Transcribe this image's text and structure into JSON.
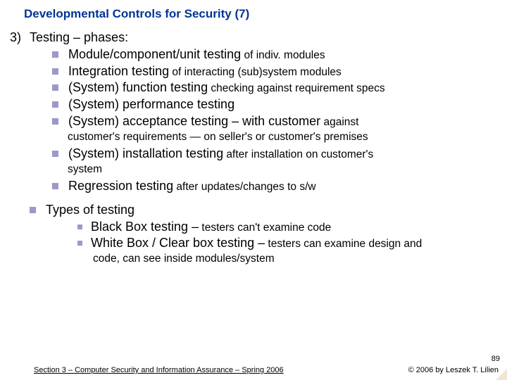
{
  "title": "Developmental Controls for Security (7)",
  "main": {
    "number": "3)",
    "heading": "Testing – phases:",
    "items": [
      {
        "main": "Module/component/unit testing",
        "tail": " of indiv. modules"
      },
      {
        "main": "Integration testing",
        "tail": " of interacting (sub)system modules"
      },
      {
        "main": "(System) function testing",
        "tail": " checking against requirement specs"
      },
      {
        "main": "(System) performance testing",
        "tail": ""
      },
      {
        "main": "(System) acceptance testing – with customer",
        "tail": " against",
        "cont": "customer's requirements — on seller's or customer's premises"
      },
      {
        "main": "(System) installation testing",
        "tail": " after installation on customer's",
        "cont": "system"
      },
      {
        "main": "Regression testing",
        "tail": " after updates/changes to s/w"
      }
    ]
  },
  "types": {
    "heading": "Types of testing",
    "items": [
      {
        "main": "Black Box testing –",
        "tail": " testers can't examine code"
      },
      {
        "main": "White Box / Clear box testing –",
        "tail": " testers can examine design and",
        "cont": "code, can see inside modules/system"
      }
    ]
  },
  "footer": {
    "left": "Section 3 – Computer Security and Information Assurance – Spring 2006",
    "right": "© 2006 by Leszek T. Lilien"
  },
  "pagenum": "89"
}
